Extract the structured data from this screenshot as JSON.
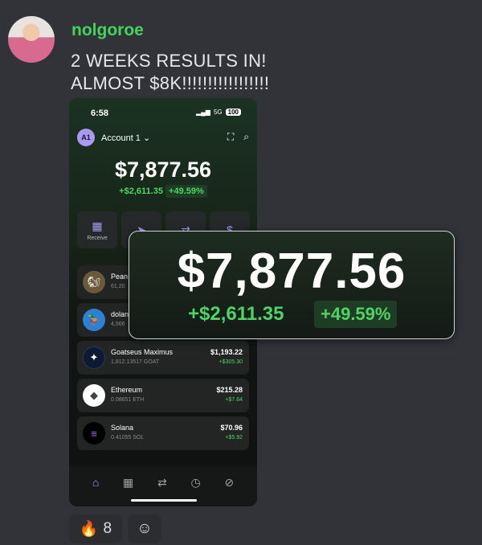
{
  "message": {
    "username": "nolgoroe",
    "line1": "2 WEEKS RESULTS IN!",
    "line2": "ALMOST $8K!!!!!!!!!!!!!!!!!"
  },
  "phone": {
    "time": "6:58",
    "network": "5G",
    "battery": "100",
    "account_initials": "A1",
    "account_name": "Account 1",
    "balance": "$7,877.56",
    "change_amount": "+$2,611.35",
    "change_percent": "+49.59%",
    "actions": [
      {
        "label": "Receive",
        "icon": "qr-icon"
      },
      {
        "label": "",
        "icon": "send-icon"
      },
      {
        "label": "",
        "icon": "swap-icon"
      },
      {
        "label": "",
        "icon": "dollar-icon"
      }
    ],
    "tokens": [
      {
        "name": "Pean",
        "sub": "61,20",
        "value": "",
        "change": "",
        "icon_color": "#6b5a3a"
      },
      {
        "name": "dolan",
        "sub": "4,566",
        "value": "",
        "change": "",
        "icon_color": "#2e7fd6"
      },
      {
        "name": "Goatseus Maximus",
        "sub": "1,812.13517 GOAT",
        "value": "$1,193.22",
        "change": "+$305.30",
        "icon_color": "#0c1a33"
      },
      {
        "name": "Ethereum",
        "sub": "0.08651 ETH",
        "value": "$215.28",
        "change": "+$7.64",
        "icon_color": "#ffffff"
      },
      {
        "name": "Solana",
        "sub": "0.41055 SOL",
        "value": "$70.96",
        "change": "+$5.92",
        "icon_color": "#000000"
      }
    ]
  },
  "zoom": {
    "balance": "$7,877.56",
    "change_amount": "+$2,611.35",
    "change_percent": "+49.59%"
  },
  "reactions": {
    "fire_emoji": "🔥",
    "fire_count": "8",
    "add_reaction_icon": "smile-icon"
  },
  "colors": {
    "background": "#313338",
    "username": "#43d45a",
    "accent": "#a99af0",
    "positive": "#4fd464"
  }
}
